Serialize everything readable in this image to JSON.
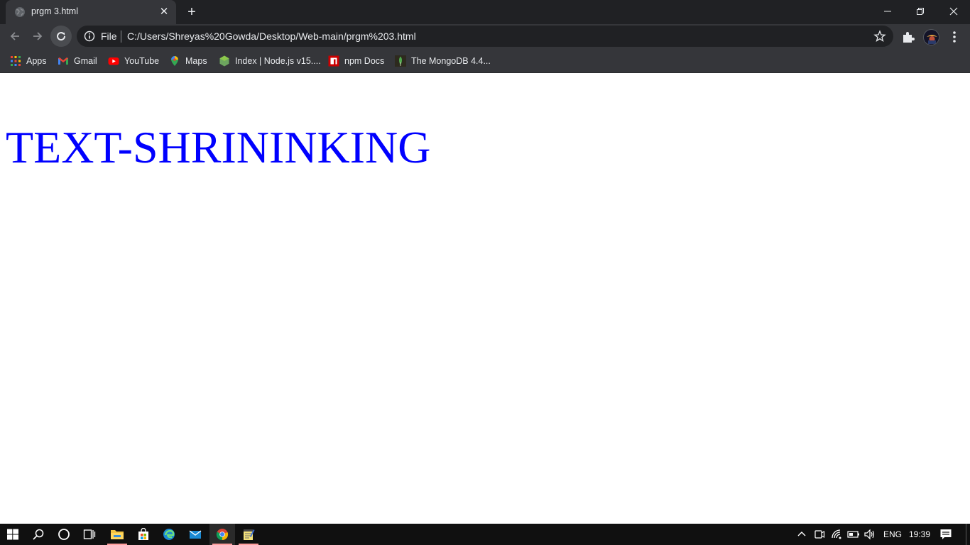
{
  "browser": {
    "tab": {
      "title": "prgm 3.html",
      "close": "✕"
    },
    "new_tab": "+",
    "window_controls": {
      "minimize": "minimize-icon",
      "restore": "restore-icon",
      "close": "close-icon"
    }
  },
  "toolbar": {
    "scheme": "File",
    "url": "C:/Users/Shreyas%20Gowda/Desktop/Web-main/prgm%203.html"
  },
  "bookmarks": [
    {
      "label": "Apps",
      "icon": "apps-grid-icon"
    },
    {
      "label": "Gmail",
      "icon": "gmail-icon"
    },
    {
      "label": "YouTube",
      "icon": "youtube-icon"
    },
    {
      "label": "Maps",
      "icon": "maps-pin-icon"
    },
    {
      "label": "Index | Node.js v15....",
      "icon": "nodejs-icon"
    },
    {
      "label": "npm Docs",
      "icon": "npm-icon"
    },
    {
      "label": "The MongoDB 4.4...",
      "icon": "mongodb-leaf-icon"
    }
  ],
  "page": {
    "heading": "TEXT-SHRININKING",
    "heading_color": "#0000ff"
  },
  "taskbar": {
    "language": "ENG",
    "time": "19:39"
  },
  "colors": {
    "titlebar": "#202124",
    "toolbar": "#35363a",
    "omnibox": "#202124",
    "taskbar": "#101010"
  }
}
